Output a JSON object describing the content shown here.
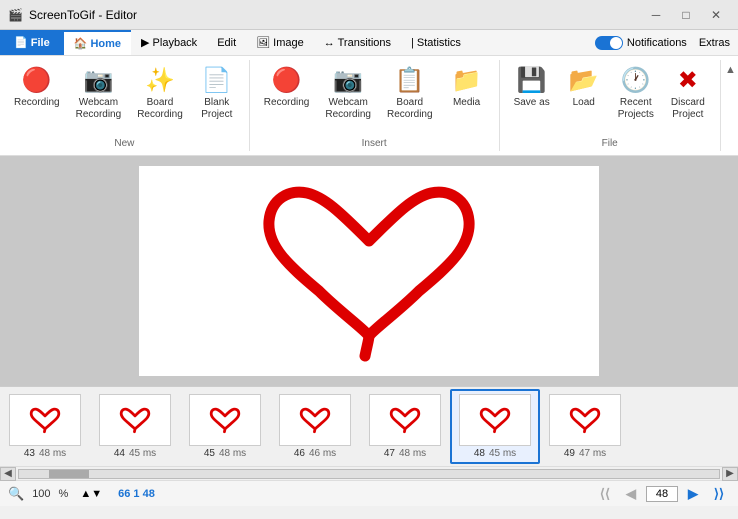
{
  "titlebar": {
    "icon": "🎬",
    "title": "ScreenToGif - Editor",
    "min": "─",
    "max": "□",
    "close": "✕"
  },
  "menubar": {
    "tabs": [
      {
        "id": "file",
        "label": "File",
        "active": false,
        "file": true
      },
      {
        "id": "home",
        "label": "Home",
        "active": true
      },
      {
        "id": "playback",
        "label": "Playback",
        "active": false
      },
      {
        "id": "edit",
        "label": "Edit",
        "active": false
      },
      {
        "id": "image",
        "label": "Image",
        "active": false
      },
      {
        "id": "transitions",
        "label": "Transitions",
        "active": false
      },
      {
        "id": "statistics",
        "label": "Statistics",
        "active": false
      }
    ],
    "notifications": "Notifications",
    "extras": "Extras"
  },
  "ribbon": {
    "new_group": {
      "label": "New",
      "buttons": [
        {
          "id": "recording",
          "icon": "🔴",
          "label": "Recording"
        },
        {
          "id": "webcam",
          "icon": "📷",
          "label": "Webcam\nRecording"
        },
        {
          "id": "board",
          "icon": "✨",
          "label": "Board\nRecording"
        },
        {
          "id": "blank",
          "icon": "📄",
          "label": "Blank\nProject"
        }
      ]
    },
    "insert_group": {
      "label": "Insert",
      "buttons": [
        {
          "id": "insert-recording",
          "icon": "🔴",
          "label": "Recording"
        },
        {
          "id": "insert-webcam",
          "icon": "📷",
          "label": "Webcam\nRecording"
        },
        {
          "id": "insert-board",
          "icon": "📋",
          "label": "Board\nRecording"
        },
        {
          "id": "media",
          "icon": "📁",
          "label": "Media"
        }
      ]
    },
    "file_group": {
      "label": "File",
      "buttons": [
        {
          "id": "save-as",
          "icon": "💾",
          "label": "Save as"
        },
        {
          "id": "load",
          "icon": "📂",
          "label": "Load"
        },
        {
          "id": "recent",
          "icon": "🕐",
          "label": "Recent\nProjects"
        },
        {
          "id": "discard",
          "icon": "✖",
          "label": "Discard\nProject"
        }
      ]
    }
  },
  "filmstrip": {
    "frames": [
      {
        "num": 43,
        "ms": 48,
        "selected": false
      },
      {
        "num": 44,
        "ms": 45,
        "selected": false
      },
      {
        "num": 45,
        "ms": 48,
        "selected": false
      },
      {
        "num": 46,
        "ms": 46,
        "selected": false
      },
      {
        "num": 47,
        "ms": 48,
        "selected": false
      },
      {
        "num": 48,
        "ms": 45,
        "selected": true
      },
      {
        "num": 49,
        "ms": 47,
        "selected": false
      }
    ]
  },
  "statusbar": {
    "zoom_icon": "🔍",
    "zoom_value": "100",
    "zoom_unit": "%",
    "frame_count": "66",
    "current_frame": "1",
    "total_ms": "48",
    "nav_first": "⟪",
    "nav_prev": "◀",
    "nav_input": "48",
    "nav_next": "▶",
    "nav_last": "⟫"
  }
}
